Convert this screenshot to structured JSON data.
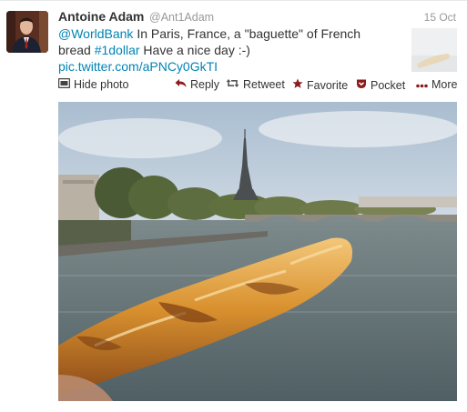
{
  "tweet": {
    "name": "Antoine Adam",
    "handle": "@Ant1Adam",
    "time": "15 Oct",
    "mention": "@WorldBank",
    "text_line1": " In Paris, France, a \"baguette\" of French",
    "text_line2_a": "bread ",
    "hashtag": "#1dollar",
    "text_line2_b": " Have a nice day :-)",
    "link": "pic.twitter.com/aPNCy0GkTI"
  },
  "actions": {
    "hide_photo": "Hide photo",
    "reply": "Reply",
    "retweet": "Retweet",
    "favorite": "Favorite",
    "pocket": "Pocket",
    "more": "More"
  },
  "icons": {
    "hide_photo": "photo-icon",
    "reply": "reply-arrow-icon",
    "retweet": "retweet-icon",
    "favorite": "star-icon",
    "pocket": "pocket-icon",
    "more": "ellipsis-icon"
  },
  "colors": {
    "link": "#0084b4",
    "text": "#333333",
    "muted": "#999999"
  }
}
